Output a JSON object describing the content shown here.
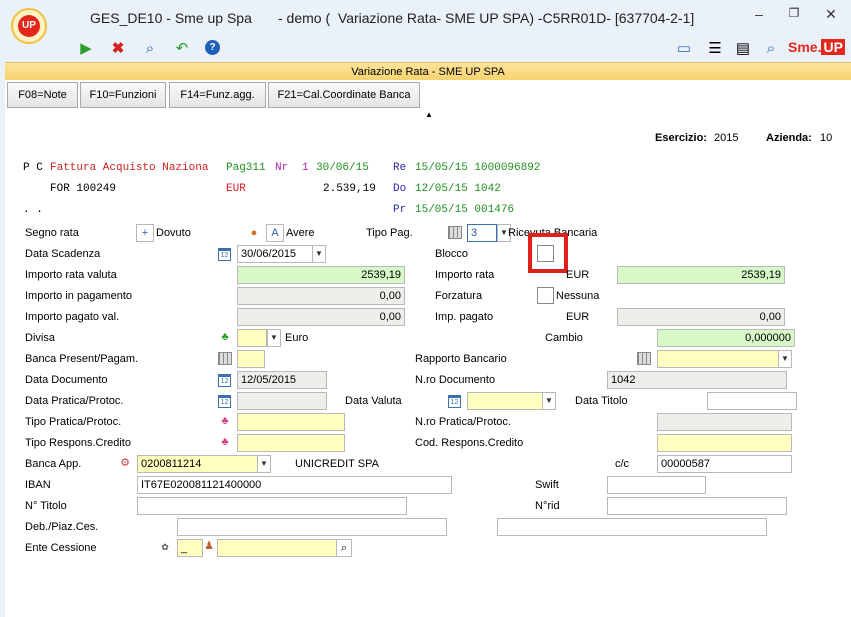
{
  "window": {
    "app_name": "GES_DE10 - Sme up Spa",
    "title": "- demo (  Variazione Rata- SME UP SPA) -C5RR01D- [637704-2-1]",
    "logo_text": "UP",
    "brand_text_a": "Sme.",
    "brand_text_b": "UP",
    "controls": {
      "minimize": "–",
      "restore": "❐",
      "close": "✕"
    }
  },
  "toolbar": {
    "left_icons": [
      "play-icon",
      "cancel-icon",
      "search-icon",
      "back-icon",
      "help-icon"
    ],
    "right_icons": [
      "monitor-icon",
      "list-icon",
      "printer-icon",
      "magnifier-icon"
    ]
  },
  "subtitle": "Variazione Rata -  SME UP SPA",
  "function_keys": [
    "F08=Note",
    "F10=Funzioni",
    "F14=Funz.agg.",
    "F21=Cal.Coordinate Banca"
  ],
  "header": {
    "esercizio_label": "Esercizio:",
    "esercizio_value": "2015",
    "azienda_label": "Azienda:",
    "azienda_value": "10"
  },
  "info": {
    "row1": {
      "pc": "P C",
      "doc": "Fattura Acquisto Naziona",
      "pag": "Pag311",
      "nr_label": "Nr",
      "nr": "1",
      "date": "30/06/15",
      "re_label": "Re",
      "re": "15/05/15 1000096892"
    },
    "row2": {
      "code": "FOR 100249",
      "currency": "EUR",
      "amount": "2.539,19",
      "do_label": "Do",
      "do": "12/05/15 1042"
    },
    "row3": {
      "dots": ". .",
      "pr_label": "Pr",
      "pr": "15/05/15 001476"
    }
  },
  "form": {
    "segno_rata": {
      "label": "Segno rata",
      "plus": "+",
      "dovuto": "Dovuto",
      "a": "A",
      "avere": "Avere"
    },
    "tipo_pag": {
      "label": "Tipo Pag.",
      "value": "3",
      "desc": "Ricevuta Bancaria"
    },
    "data_scadenza": {
      "label": "Data Scadenza",
      "value": "30/06/2015"
    },
    "blocco": {
      "label": "Blocco"
    },
    "importo_rata_valuta": {
      "label": "Importo rata valuta",
      "value": "2539,19"
    },
    "importo_rata": {
      "label": "Importo rata",
      "currency": "EUR",
      "value": "2539,19"
    },
    "importo_in_pagamento": {
      "label": "Importo in pagamento",
      "value": "0,00"
    },
    "forzatura": {
      "label": "Forzatura",
      "value": "Nessuna"
    },
    "importo_pagato_val": {
      "label": "Importo pagato val.",
      "value": "0,00"
    },
    "imp_pagato": {
      "label": "Imp. pagato",
      "currency": "EUR",
      "value": "0,00"
    },
    "divisa": {
      "label": "Divisa",
      "desc": "Euro"
    },
    "cambio": {
      "label": "Cambio",
      "value": "0,000000"
    },
    "banca_present": {
      "label": "Banca Present/Pagam."
    },
    "rapporto_bancario": {
      "label": "Rapporto Bancario"
    },
    "data_documento": {
      "label": "Data Documento",
      "value": "12/05/2015"
    },
    "nro_documento": {
      "label": "N.ro Documento",
      "value": "1042"
    },
    "data_pratica": {
      "label": "Data Pratica/Protoc."
    },
    "data_valuta": {
      "label": "Data Valuta"
    },
    "data_titolo": {
      "label": "Data Titolo"
    },
    "tipo_pratica": {
      "label": "Tipo Pratica/Protoc."
    },
    "nro_pratica": {
      "label": "N.ro Pratica/Protoc."
    },
    "tipo_respons": {
      "label": "Tipo Respons.Credito"
    },
    "cod_respons": {
      "label": "Cod. Respons.Credito"
    },
    "banca_app": {
      "label": "Banca App.",
      "value": "0200811214",
      "desc": "UNICREDIT SPA"
    },
    "cc": {
      "label": "c/c",
      "value": "00000587"
    },
    "iban": {
      "label": "IBAN",
      "value": "IT67E020081121400000"
    },
    "swift": {
      "label": "Swift"
    },
    "n_titolo": {
      "label": "N° Titolo"
    },
    "n_rid": {
      "label": "N°rid"
    },
    "deb_piaz": {
      "label": "Deb./Piaz.Ces."
    },
    "ente_cessione": {
      "label": "Ente Cessione",
      "value": "_"
    }
  },
  "colors": {
    "accent_red": "#e3281b",
    "title_bar_yellow": "#f7d36c",
    "green_field": "#d8f8c8",
    "yellow_field": "#ffffc0"
  }
}
